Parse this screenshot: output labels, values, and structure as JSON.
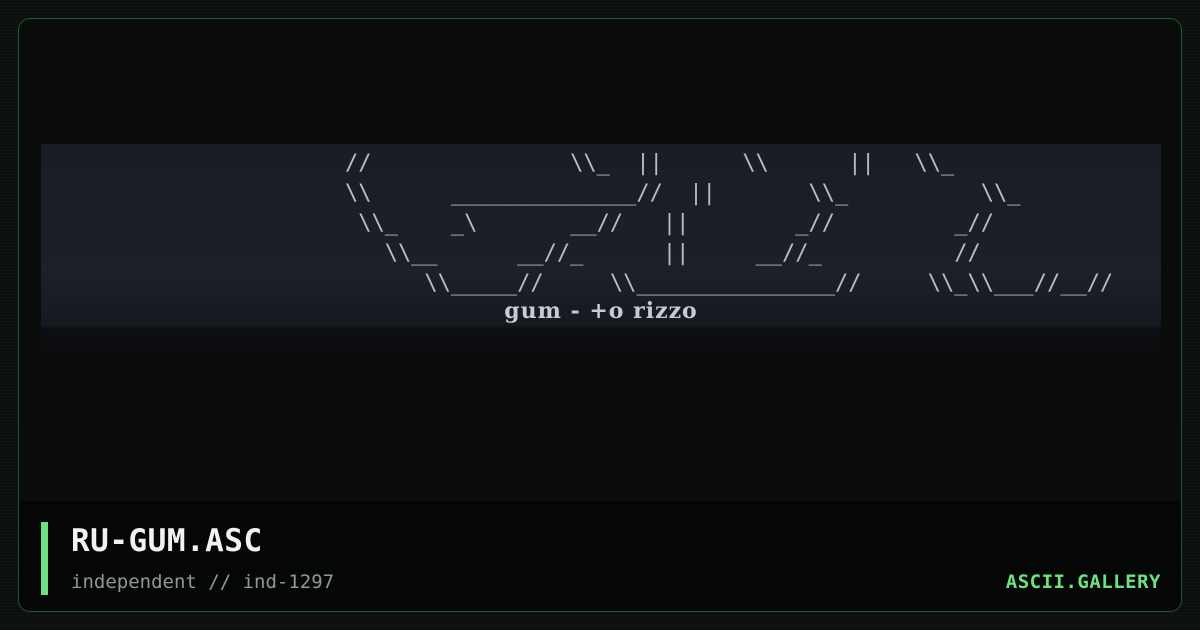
{
  "artwork": {
    "ascii_lines": [
      "        //               \\\\_  ||      \\\\      ||   \\\\_",
      "        \\\\      ______________//  ||       \\\\_          \\\\_",
      "         \\\\_    _\\       __//   ||        _//         _//",
      "           \\\\__      __//_      ||     __//_          //",
      "              \\\\_____//     \\\\_______________//     \\\\_\\\\___//__//"
    ],
    "caption": "gum - +o rizzo"
  },
  "footer": {
    "title": "RU-GUM.ASC",
    "subtitle": "independent // ind-1297",
    "brand": "ASCII.GALLERY"
  },
  "colors": {
    "accent": "#6be384",
    "border": "#1f5a2a",
    "background": "#0b0f0e",
    "art_panel": "#1c2027"
  }
}
